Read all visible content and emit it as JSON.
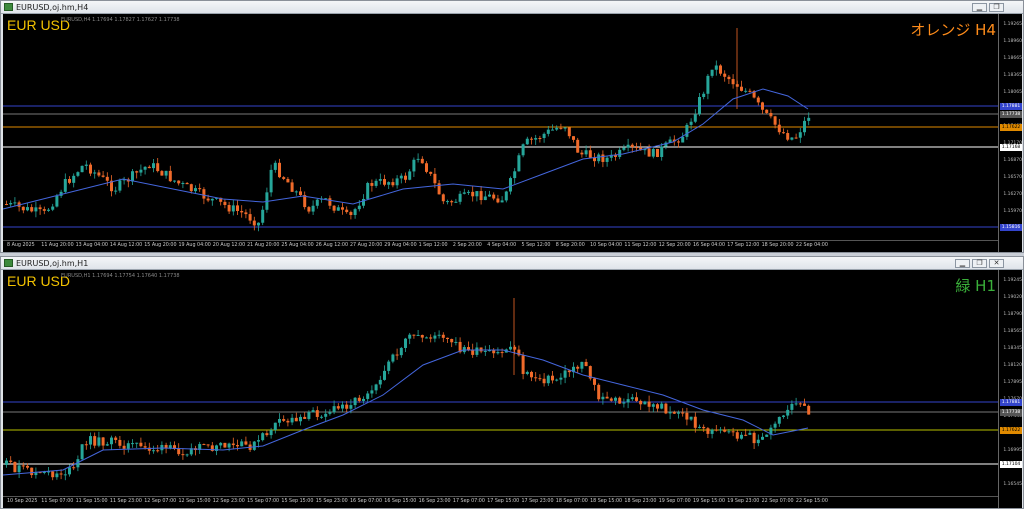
{
  "colors": {
    "bull": "#26a69a",
    "bear": "#f06a2a",
    "ma": "#4466dd",
    "blue_line": "#3344cc",
    "orange_line": "#e08a00",
    "green_line": "#b8c000",
    "white_line": "#ffffff"
  },
  "windows": [
    {
      "title": "EURUSD,oj.hm,H4",
      "symbol": "EUR USD",
      "ohlc": "EURUSD,H4  1.17694 1.17827 1.17627 1.17738",
      "tag": "オレンジ H4",
      "tag_color": "#ff8c1a",
      "price_labels": [
        "1.19265",
        "1.18960",
        "1.18665",
        "1.18365",
        "1.18065",
        "1.17765",
        "1.17465",
        "1.17170",
        "1.16870",
        "1.16570",
        "1.16270",
        "1.15970",
        "1.15670"
      ],
      "badges": [
        {
          "text": "1.17881",
          "kind": "blue"
        },
        {
          "text": "1.17738",
          "kind": "gray"
        },
        {
          "text": "1.17622",
          "kind": "orange"
        },
        {
          "text": "1.17168",
          "kind": "white"
        },
        {
          "text": "1.15816",
          "kind": "blue"
        }
      ],
      "time_labels": [
        "8 Aug 2025",
        "11 Aug 20:00",
        "13 Aug 04:00",
        "14 Aug 12:00",
        "15 Aug 20:00",
        "19 Aug 04:00",
        "20 Aug 12:00",
        "21 Aug 20:00",
        "25 Aug 04:00",
        "26 Aug 12:00",
        "27 Aug 20:00",
        "29 Aug 04:00",
        "1 Sep 12:00",
        "2 Sep 20:00",
        "4 Sep 04:00",
        "5 Sep 12:00",
        "8 Sep 20:00",
        "10 Sep 04:00",
        "11 Sep 12:00",
        "12 Sep 20:00",
        "16 Sep 04:00",
        "17 Sep 12:00",
        "18 Sep 20:00",
        "22 Sep 04:00"
      ]
    },
    {
      "title": "EURUSD,oj.hm,H1",
      "symbol": "EUR USD",
      "ohlc": "EURUSD,H1  1.17694 1.17754 1.17640 1.17738",
      "tag": "緑 H1",
      "tag_color": "#3ab03a",
      "price_labels": [
        "1.19245",
        "1.19020",
        "1.18790",
        "1.18565",
        "1.18345",
        "1.18120",
        "1.17895",
        "1.17670",
        "1.17445",
        "1.17220",
        "1.16995",
        "1.16770",
        "1.16545"
      ],
      "badges": [
        {
          "text": "1.17881",
          "kind": "blue"
        },
        {
          "text": "1.17738",
          "kind": "gray"
        },
        {
          "text": "1.17622",
          "kind": "orange"
        },
        {
          "text": "1.17104",
          "kind": "white"
        }
      ],
      "time_labels": [
        "10 Sep 2025",
        "11 Sep 07:00",
        "11 Sep 15:00",
        "11 Sep 23:00",
        "12 Sep 07:00",
        "12 Sep 15:00",
        "12 Sep 23:00",
        "15 Sep 07:00",
        "15 Sep 15:00",
        "15 Sep 23:00",
        "16 Sep 07:00",
        "16 Sep 15:00",
        "16 Sep 23:00",
        "17 Sep 07:00",
        "17 Sep 15:00",
        "17 Sep 23:00",
        "18 Sep 07:00",
        "18 Sep 15:00",
        "18 Sep 23:00",
        "19 Sep 07:00",
        "19 Sep 15:00",
        "19 Sep 23:00",
        "22 Sep 07:00",
        "22 Sep 15:00"
      ]
    }
  ]
}
